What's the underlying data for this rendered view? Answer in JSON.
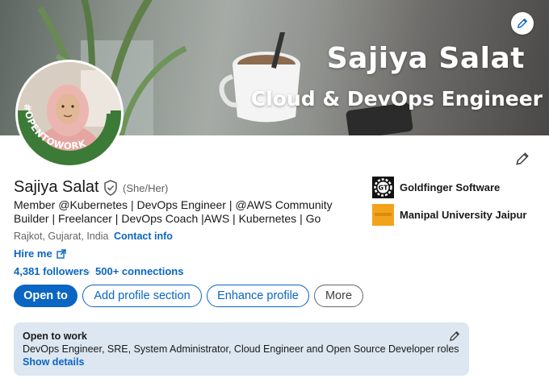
{
  "banner": {
    "name": "Sajiya Salat",
    "title": "Cloud & DevOps Engineer"
  },
  "avatar": {
    "badge": "#OPENTOWORK"
  },
  "profile": {
    "name": "Sajiya Salat",
    "pronouns": "(She/Her)",
    "headline": "Member @Kubernetes | DevOps Engineer | @AWS Community Builder | Freelancer | DevOps Coach |AWS | Kubernetes | Go",
    "location": "Rajkot, Gujarat, India",
    "contact_label": "Contact info",
    "hire_label": "Hire me",
    "followers": "4,381 followers",
    "separator": "·",
    "connections": "500+ connections"
  },
  "actions": {
    "open_to": "Open to",
    "add_section": "Add profile section",
    "enhance": "Enhance profile",
    "more": "More"
  },
  "experience": [
    {
      "name": "Goldfinger Software",
      "logo_text": "GT"
    },
    {
      "name": "Manipal University Jaipur"
    }
  ],
  "open_to_work": {
    "title": "Open to work",
    "roles": "DevOps Engineer, SRE, System Administrator, Cloud Engineer and Open Source Developer roles",
    "details_link": "Show details"
  },
  "colors": {
    "link_blue": "#0a66c2",
    "opentowork_green": "#3b7a37",
    "otw_card_bg": "#dde7f1",
    "manipal_orange": "#f2a31b"
  },
  "icons": {
    "banner_edit": "pencil-icon",
    "intro_edit": "pencil-icon",
    "verified": "shield-check-icon",
    "hire_external": "external-link-icon",
    "otw_edit": "pencil-icon"
  }
}
